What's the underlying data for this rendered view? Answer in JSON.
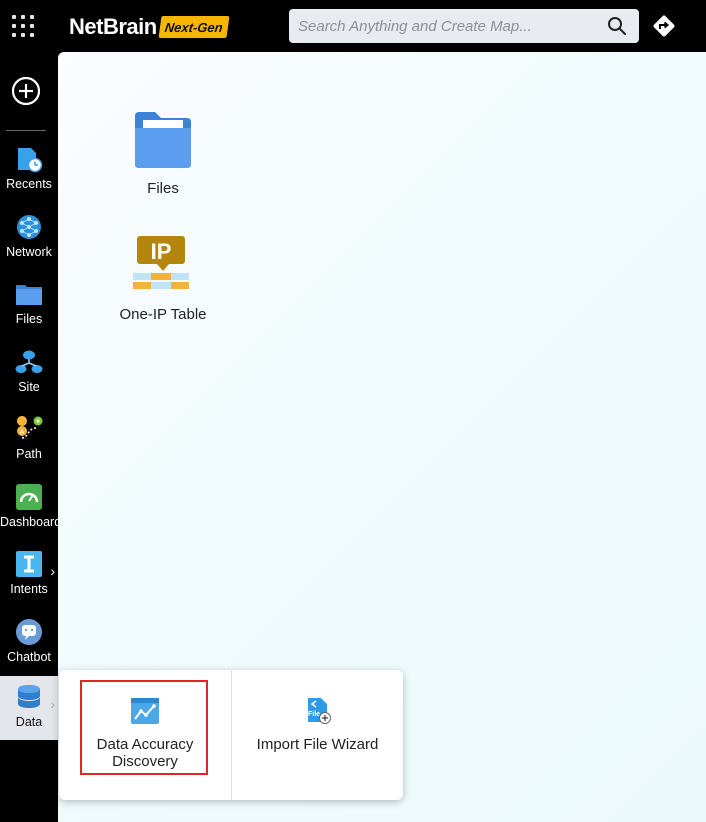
{
  "header": {
    "logo_text": "NetBrain",
    "logo_badge": "Next-Gen",
    "search_placeholder": "Search Anything and Create Map..."
  },
  "sidebar": {
    "items": [
      {
        "label": "Recents",
        "icon": "recents-icon"
      },
      {
        "label": "Network",
        "icon": "network-icon"
      },
      {
        "label": "Files",
        "icon": "files-icon"
      },
      {
        "label": "Site",
        "icon": "site-icon"
      },
      {
        "label": "Path",
        "icon": "path-icon"
      },
      {
        "label": "Dashboard",
        "icon": "dashboard-icon"
      },
      {
        "label": "Intents",
        "icon": "intents-icon"
      },
      {
        "label": "Chatbot",
        "icon": "chatbot-icon"
      },
      {
        "label": "Data",
        "icon": "database-icon"
      }
    ]
  },
  "main": {
    "tiles": [
      {
        "label": "Files",
        "icon": "folder-icon"
      },
      {
        "label": "One-IP Table",
        "icon": "ip-table-icon"
      }
    ]
  },
  "data_menu": {
    "items": [
      {
        "label": "Data Accuracy Discovery",
        "icon": "data-accuracy-icon"
      },
      {
        "label": "Import File Wizard",
        "icon": "import-file-icon"
      }
    ]
  },
  "colors": {
    "accent_yellow": "#f7b500",
    "folder_blue": "#4a90e2",
    "highlight_red": "#e02626",
    "active_item_bg": "#e3e6ea"
  }
}
